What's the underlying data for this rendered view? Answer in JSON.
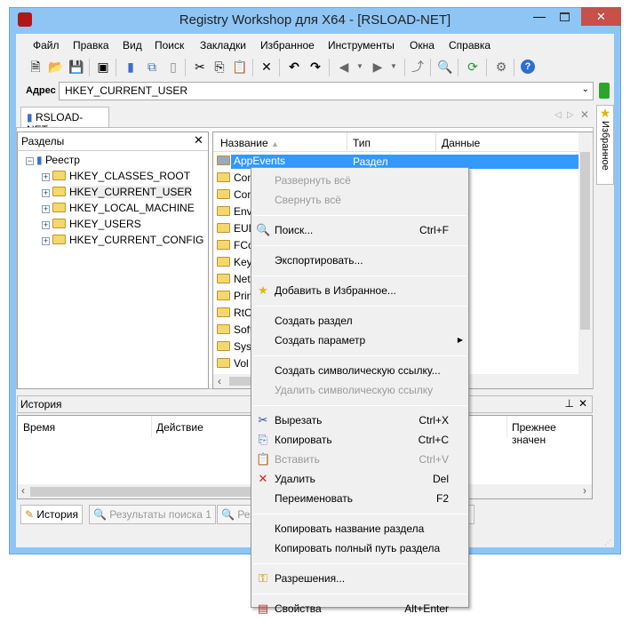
{
  "window": {
    "title": "Registry Workshop для X64 - [RSLOAD-NET]",
    "accent": "#8ec5f5",
    "close_color": "#c7504a"
  },
  "menu": [
    "Файл",
    "Правка",
    "Вид",
    "Поиск",
    "Закладки",
    "Избранное",
    "Инструменты",
    "Окна",
    "Справка"
  ],
  "address": {
    "label": "Адрес",
    "value": "HKEY_CURRENT_USER"
  },
  "doc_tab": "RSLOAD-NET",
  "favorites_tab": "Избранное",
  "tree": {
    "title": "Разделы",
    "root": "Реестр",
    "items": [
      "HKEY_CLASSES_ROOT",
      "HKEY_CURRENT_USER",
      "HKEY_LOCAL_MACHINE",
      "HKEY_USERS",
      "HKEY_CURRENT_CONFIG"
    ]
  },
  "list": {
    "columns": [
      "Название",
      "Тип",
      "Данные"
    ],
    "selected": {
      "name": "AppEvents",
      "type": "Раздел"
    },
    "items": [
      "Con",
      "Con",
      "Env",
      "EUD",
      "FCo",
      "Key",
      "Net",
      "Prin",
      "RtC",
      "Soft",
      "Syst",
      "Vol"
    ]
  },
  "history": {
    "title": "История",
    "columns": [
      "Время",
      "Действие",
      "Прежнее значен"
    ]
  },
  "bottom_tabs": [
    "История",
    "Результаты поиска 1",
    "Рез"
  ],
  "context_menu": [
    {
      "label": "Развернуть всё",
      "disabled": true
    },
    {
      "label": "Свернуть всё",
      "disabled": true
    },
    {
      "sep": true
    },
    {
      "label": "Поиск...",
      "shortcut": "Ctrl+F",
      "icon": "search-icon"
    },
    {
      "sep": true
    },
    {
      "label": "Экспортировать..."
    },
    {
      "sep": true
    },
    {
      "label": "Добавить в Избранное...",
      "icon": "star-icon"
    },
    {
      "sep": true
    },
    {
      "label": "Создать раздел"
    },
    {
      "label": "Создать параметр",
      "submenu": true
    },
    {
      "sep": true
    },
    {
      "label": "Создать символическую ссылку..."
    },
    {
      "label": "Удалить символическую ссылку",
      "disabled": true
    },
    {
      "sep": true
    },
    {
      "label": "Вырезать",
      "shortcut": "Ctrl+X",
      "icon": "scissors-icon"
    },
    {
      "label": "Копировать",
      "shortcut": "Ctrl+C",
      "icon": "copy-icon"
    },
    {
      "label": "Вставить",
      "shortcut": "Ctrl+V",
      "icon": "paste-icon",
      "disabled": true
    },
    {
      "label": "Удалить",
      "shortcut": "Del",
      "icon": "delete-icon"
    },
    {
      "label": "Переименовать",
      "shortcut": "F2"
    },
    {
      "sep": true
    },
    {
      "label": "Копировать название раздела"
    },
    {
      "label": "Копировать полный путь раздела"
    },
    {
      "sep": true
    },
    {
      "label": "Разрешения...",
      "icon": "key-icon"
    },
    {
      "sep": true
    },
    {
      "label": "Свойства",
      "shortcut": "Alt+Enter",
      "icon": "properties-icon"
    }
  ]
}
